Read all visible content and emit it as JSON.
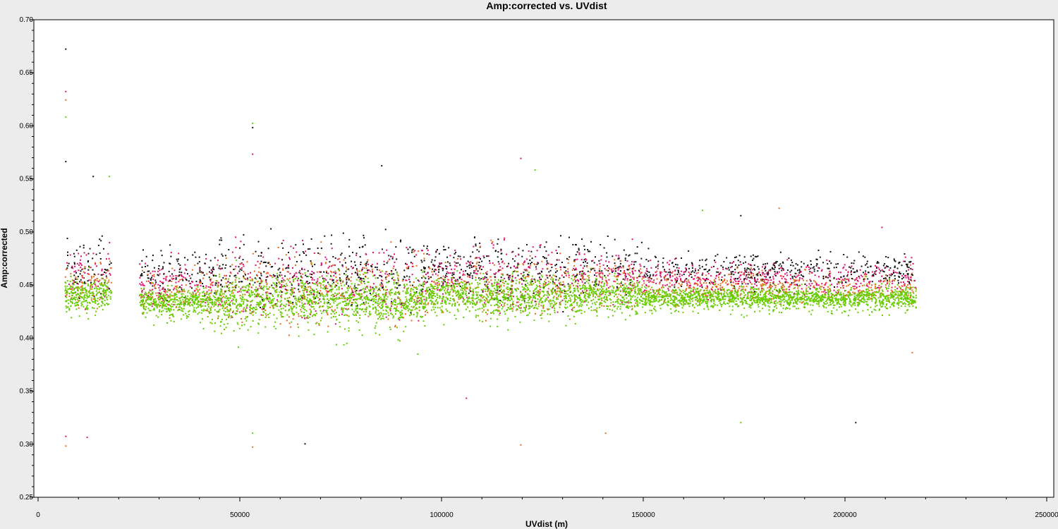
{
  "chart_data": {
    "type": "scatter",
    "title": "Amp:corrected vs. UVdist",
    "xlabel": "UVdist (m)",
    "ylabel": "Amp:corrected",
    "xlim": [
      0,
      250000
    ],
    "ylim": [
      0.25,
      0.7
    ],
    "x_ticks": [
      0,
      50000,
      100000,
      150000,
      200000,
      250000
    ],
    "x_tick_labels": [
      "0",
      "50000",
      "100000",
      "150000",
      "200000",
      "250000"
    ],
    "y_ticks": [
      0.25,
      0.3,
      0.35,
      0.4,
      0.45,
      0.5,
      0.55,
      0.6,
      0.65,
      0.7
    ],
    "y_tick_labels": [
      "0.25",
      "0.30",
      "0.35",
      "0.40",
      "0.45",
      "0.50",
      "0.55",
      "0.60",
      "0.65",
      "0.70"
    ],
    "grid": false,
    "series_colors": [
      "#111111",
      "#e0106e",
      "#e86b1c",
      "#66cc00"
    ],
    "clusters": [
      {
        "x_range": [
          6500,
          18000
        ],
        "y_center": 0.45,
        "y_spread": 0.045
      },
      {
        "x_range": [
          25000,
          44000
        ],
        "y_center": 0.443,
        "y_spread": 0.04
      },
      {
        "x_range": [
          44000,
          96000
        ],
        "y_center": 0.445,
        "y_spread": 0.065
      },
      {
        "x_range": [
          96000,
          108000
        ],
        "y_center": 0.45,
        "y_spread": 0.045
      },
      {
        "x_range": [
          108000,
          135000
        ],
        "y_center": 0.448,
        "y_spread": 0.06
      },
      {
        "x_range": [
          135000,
          149500
        ],
        "y_center": 0.45,
        "y_spread": 0.045
      },
      {
        "x_range": [
          149500,
          217500
        ],
        "y_center": 0.447,
        "y_spread": 0.03
      }
    ],
    "outliers": [
      {
        "x": 6700,
        "y": 0.673
      },
      {
        "x": 6700,
        "y": 0.633
      },
      {
        "x": 6700,
        "y": 0.625
      },
      {
        "x": 6700,
        "y": 0.609
      },
      {
        "x": 6700,
        "y": 0.567
      },
      {
        "x": 6700,
        "y": 0.308
      },
      {
        "x": 6700,
        "y": 0.299
      },
      {
        "x": 53000,
        "y": 0.603
      },
      {
        "x": 53000,
        "y": 0.599
      },
      {
        "x": 53000,
        "y": 0.574
      },
      {
        "x": 53000,
        "y": 0.298
      },
      {
        "x": 53000,
        "y": 0.311
      },
      {
        "x": 66000,
        "y": 0.301
      },
      {
        "x": 119500,
        "y": 0.57
      },
      {
        "x": 119500,
        "y": 0.3
      },
      {
        "x": 123000,
        "y": 0.559
      },
      {
        "x": 85000,
        "y": 0.563
      },
      {
        "x": 12000,
        "y": 0.307
      },
      {
        "x": 140500,
        "y": 0.311
      },
      {
        "x": 174000,
        "y": 0.321
      },
      {
        "x": 202500,
        "y": 0.321
      },
      {
        "x": 106000,
        "y": 0.344
      },
      {
        "x": 183500,
        "y": 0.523
      },
      {
        "x": 164500,
        "y": 0.521
      },
      {
        "x": 174000,
        "y": 0.516
      },
      {
        "x": 209000,
        "y": 0.505
      },
      {
        "x": 216500,
        "y": 0.387
      },
      {
        "x": 17500,
        "y": 0.553
      },
      {
        "x": 13500,
        "y": 0.553
      }
    ]
  }
}
